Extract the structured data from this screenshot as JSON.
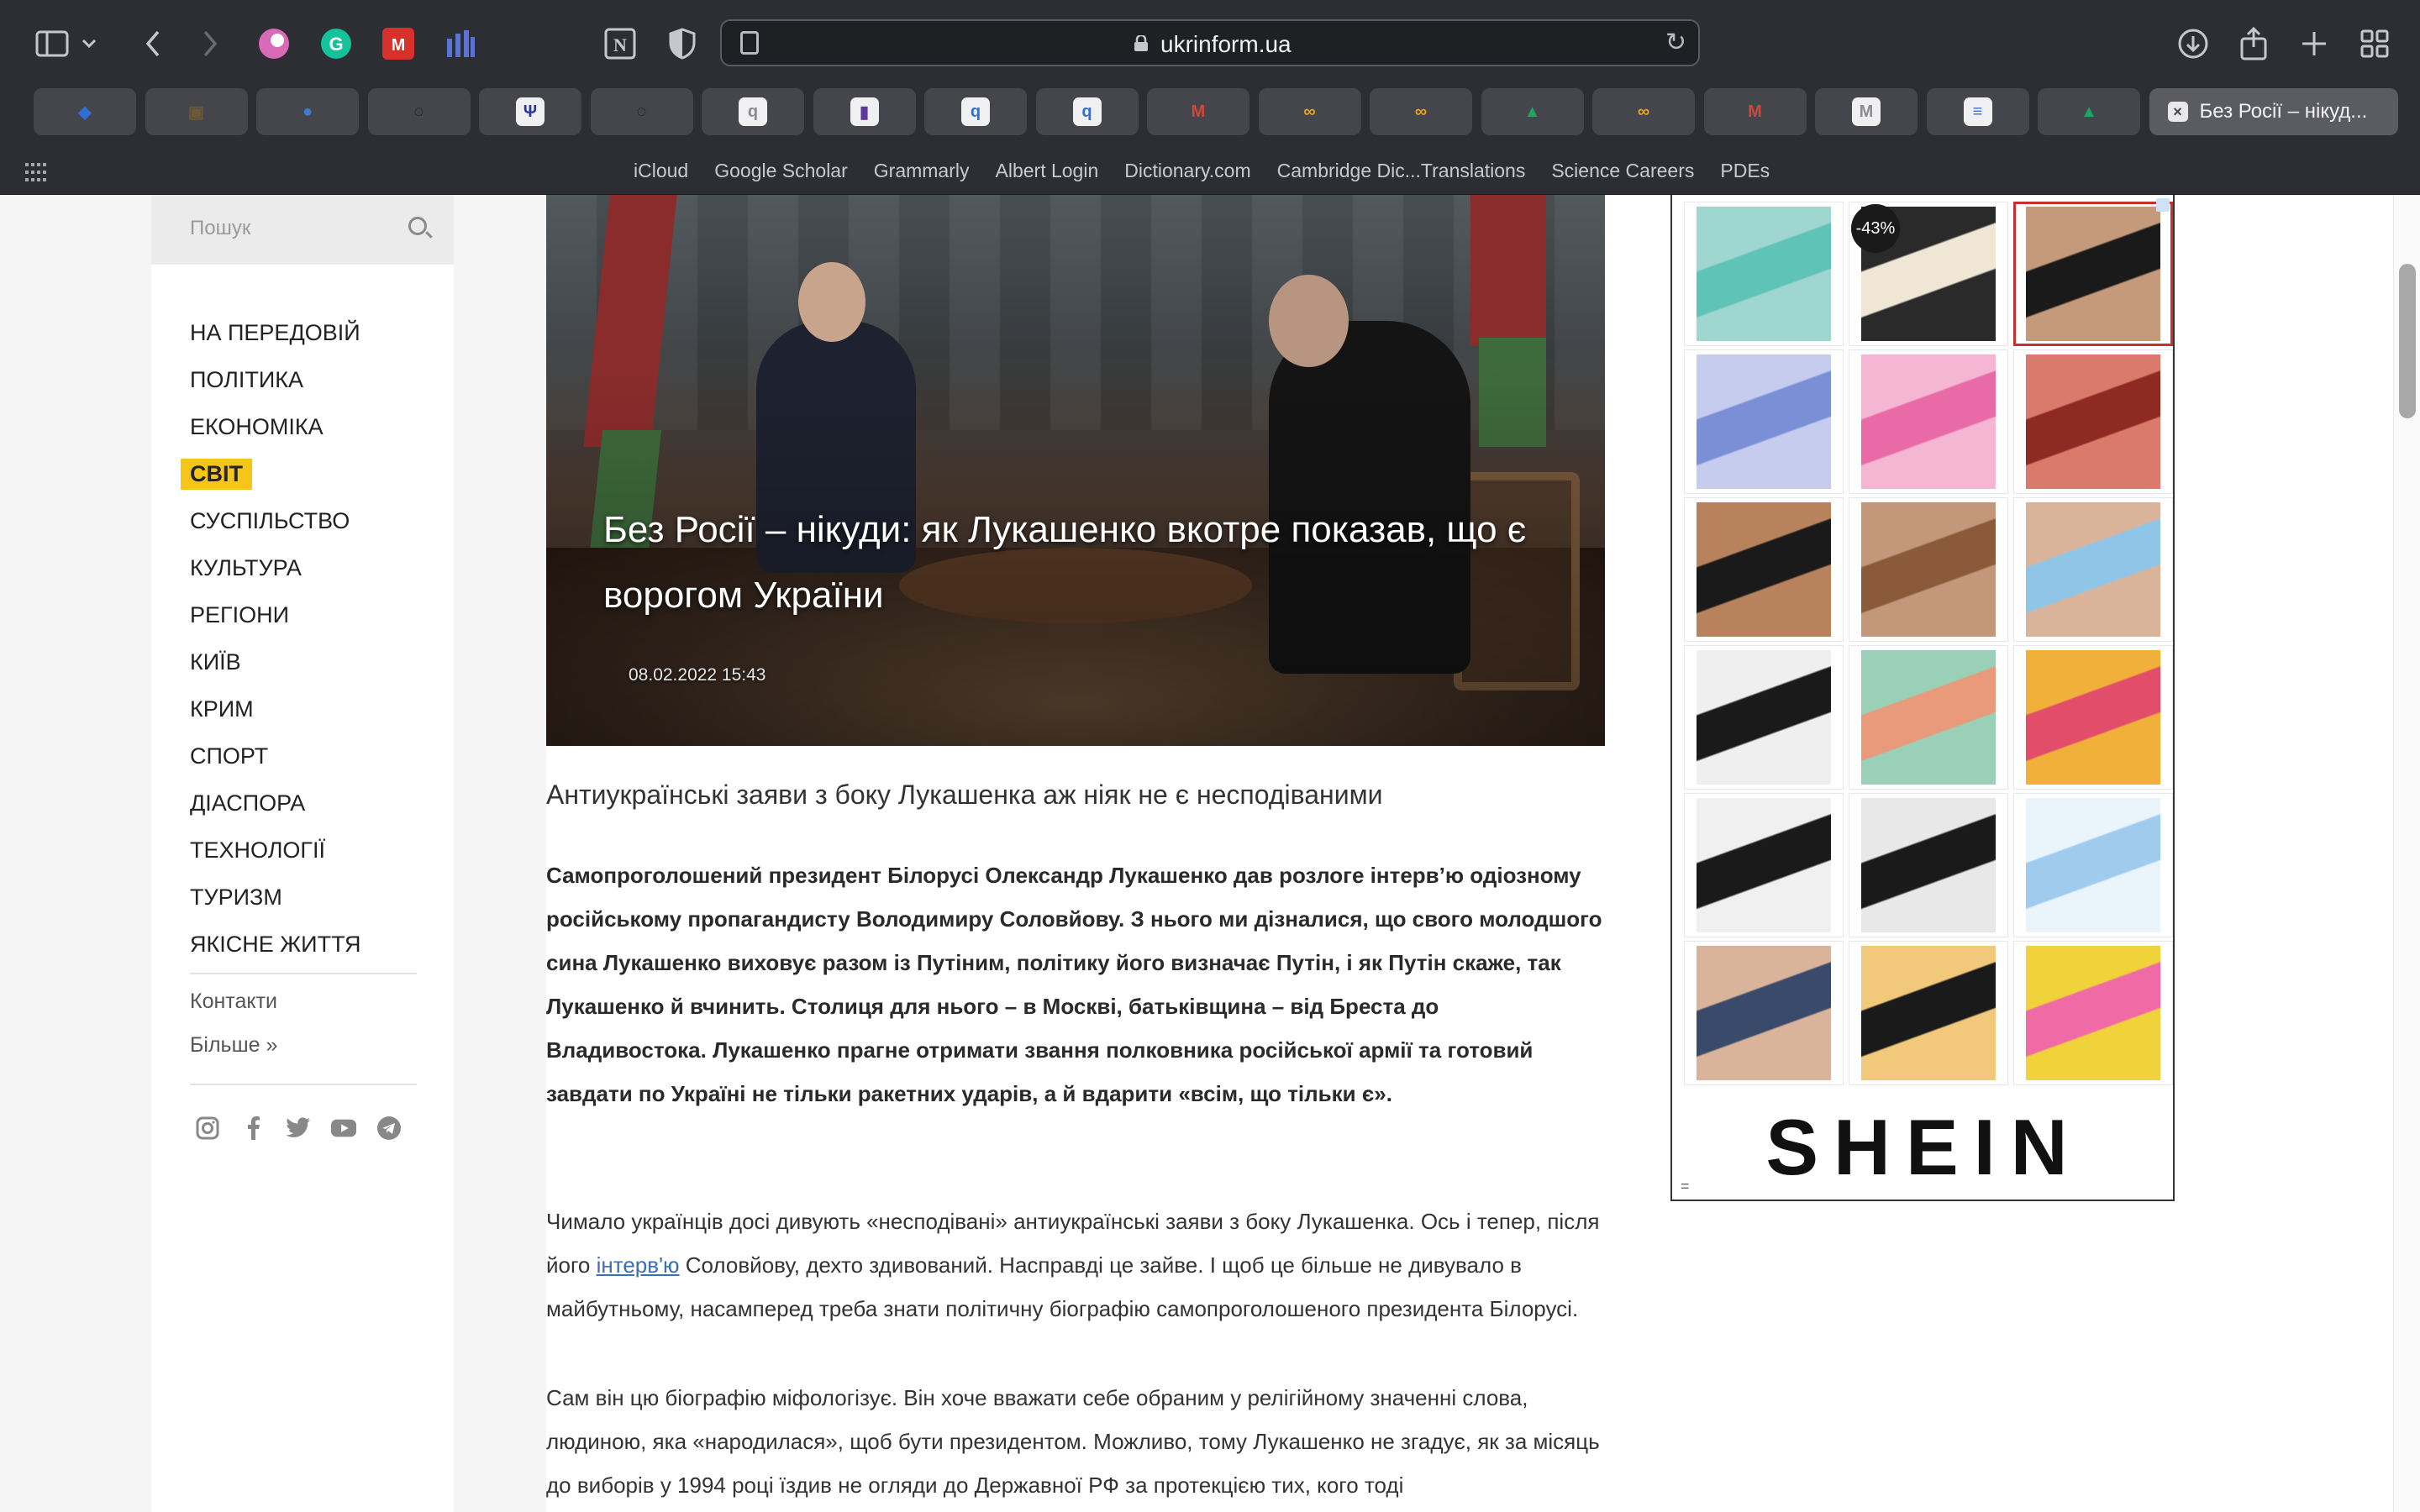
{
  "browser": {
    "url": "ukrinform.ua",
    "toolbar_icons": [
      "sidebar-icon",
      "chevron-down-icon",
      "back-icon",
      "forward-icon",
      "extension-pink-icon",
      "grammarly-icon",
      "mendeley-icon",
      "extension-bars-icon",
      "notion-icon",
      "privacy-shield-icon"
    ],
    "right_icons": [
      "downloads-icon",
      "share-icon",
      "new-tab-icon",
      "tab-overview-icon"
    ],
    "tabs": [
      {
        "icon": "diamond-icon",
        "color": "#2f6fd6"
      },
      {
        "icon": "photo-icon",
        "color": "#6b5a3a"
      },
      {
        "icon": "chat-icon",
        "color": "#3f7bd6"
      },
      {
        "icon": "circle-icon",
        "color": "#111111"
      },
      {
        "icon": "brand-icon",
        "color": "#2a3a9a"
      },
      {
        "icon": "circle-icon",
        "color": "#111111"
      },
      {
        "icon": "q-icon",
        "color": "#8a8a90"
      },
      {
        "icon": "bookmark-icon",
        "color": "#5b3aa0"
      },
      {
        "icon": "q-icon",
        "color": "#2f6fd6"
      },
      {
        "icon": "q-icon",
        "color": "#2f6fd6"
      },
      {
        "icon": "gmail-icon",
        "color": "#d44638"
      },
      {
        "icon": "infinity-icon",
        "color": "#f0a020"
      },
      {
        "icon": "infinity-icon",
        "color": "#f0a020"
      },
      {
        "icon": "drive-icon",
        "color": "#1fa463"
      },
      {
        "icon": "infinity-icon",
        "color": "#f0a020"
      },
      {
        "icon": "gmail-icon",
        "color": "#d44638"
      },
      {
        "icon": "m-icon",
        "color": "#8a8a90"
      },
      {
        "icon": "docs-icon",
        "color": "#3a6fd6"
      },
      {
        "icon": "drive-icon",
        "color": "#1fa463"
      }
    ],
    "active_tab_title": "Без Росії – нікуд...",
    "bookmarks": [
      "iCloud",
      "Google Scholar",
      "Grammarly",
      "Albert Login",
      "Dictionary.com",
      "Cambridge Dic...Translations",
      "Science Careers",
      "PDEs"
    ]
  },
  "sidebar": {
    "search_placeholder": "Пошук",
    "nav": [
      {
        "label": "НА ПЕРЕДОВІЙ",
        "active": false
      },
      {
        "label": "ПОЛІТИКА",
        "active": false
      },
      {
        "label": "ЕКОНОМІКА",
        "active": false
      },
      {
        "label": "СВІТ",
        "active": true
      },
      {
        "label": "СУСПІЛЬСТВО",
        "active": false
      },
      {
        "label": "КУЛЬТУРА",
        "active": false
      },
      {
        "label": "РЕГІОНИ",
        "active": false
      },
      {
        "label": "КИЇВ",
        "active": false
      },
      {
        "label": "КРИМ",
        "active": false
      },
      {
        "label": "СПОРТ",
        "active": false
      },
      {
        "label": "ДІАСПОРА",
        "active": false
      },
      {
        "label": "ТЕХНОЛОГІЇ",
        "active": false
      },
      {
        "label": "ТУРИЗМ",
        "active": false
      },
      {
        "label": "ЯКІСНЕ ЖИТТЯ",
        "active": false
      }
    ],
    "contacts": "Контакти",
    "more": "Більше »",
    "social": [
      "instagram-icon",
      "facebook-icon",
      "twitter-icon",
      "youtube-icon",
      "telegram-icon"
    ]
  },
  "article": {
    "title": "Без Росії – нікуди: як Лукашенко вкотре показав, що є ворогом України",
    "date": "08.02.2022 15:43",
    "lead": "Антиукраїнські заяви з боку Лукашенка аж ніяк не є несподіваними",
    "intro": "Самопроголошений президент Білорусі Олександр Лукашенко дав розлоге інтерв’ю одіозному російському пропагандисту Володимиру Соловйову. З нього ми дізналися, що свого молодшого сина Лукашенко виховує разом із Путіним, політику його визначає Путін, і як Путін скаже, так Лукашенко й вчинить. Столиця для нього – в Москві, батьківщина – від Бреста до Владивостока. Лукашенко прагне отримати звання полковника російської армії та готовий завдати по Україні не тільки ракетних ударів, а й вдарити «всім, що тільки є».",
    "p1_before": "Чимало українців досі дивують «несподівані» антиукраїнські заяви з боку Лукашенка. Ось і тепер, після його ",
    "p1_link": "інтерв'ю",
    "p1_after": " Соловйову, дехто здивований. Насправді це зайве. І щоб це більше не дивувало в майбутньому, насамперед треба знати політичну біографію самопроголошеного президента Білорусі.",
    "p2": "Сам він цю біографію міфологізує. Він хоче вважати себе обраним у релігійному значенні слова, людиною, яка «народилася», щоб бути президентом. Можливо, тому Лукашенко не згадує, як за місяць до виборів у 1994 році їздив не огляди до Державної РФ за протекцією тих, кого тоді"
  },
  "ad": {
    "brand": "SHEIN",
    "discount_badge": "-43%",
    "menu_glyph": "=",
    "products": [
      {
        "colors": [
          "#5fc3b8",
          "#9fd6cf"
        ]
      },
      {
        "colors": [
          "#efe6d6",
          "#2a2a2a"
        ]
      },
      {
        "colors": [
          "#1a1a1a",
          "#c49a7a"
        ]
      },
      {
        "colors": [
          "#7b8fd6",
          "#c5ccee"
        ]
      },
      {
        "colors": [
          "#e86aa6",
          "#f5b6d3"
        ]
      },
      {
        "colors": [
          "#8e2a22",
          "#d97a6c"
        ]
      },
      {
        "colors": [
          "#1a1a1a",
          "#b8835c"
        ]
      },
      {
        "colors": [
          "#8a5a3a",
          "#c2977a"
        ]
      },
      {
        "colors": [
          "#8fc6e8",
          "#d9b49a"
        ]
      },
      {
        "colors": [
          "#1a1a1a",
          "#efefef"
        ]
      },
      {
        "colors": [
          "#e89a7a",
          "#9ad0b8"
        ]
      },
      {
        "colors": [
          "#e24d6a",
          "#f0b03a"
        ]
      },
      {
        "colors": [
          "#1a1a1a",
          "#f0f0f0"
        ]
      },
      {
        "colors": [
          "#1a1a1a",
          "#e8e8e8"
        ]
      },
      {
        "colors": [
          "#9ecbee",
          "#eaf4fb"
        ]
      },
      {
        "colors": [
          "#3a4a6a",
          "#d9b49a"
        ]
      },
      {
        "colors": [
          "#1a1a1a",
          "#f2c87a"
        ]
      },
      {
        "colors": [
          "#f06aa6",
          "#f0d23a"
        ]
      }
    ]
  },
  "colors": {
    "accent_active_nav": "#f5c518",
    "link": "#3a6fb3"
  }
}
